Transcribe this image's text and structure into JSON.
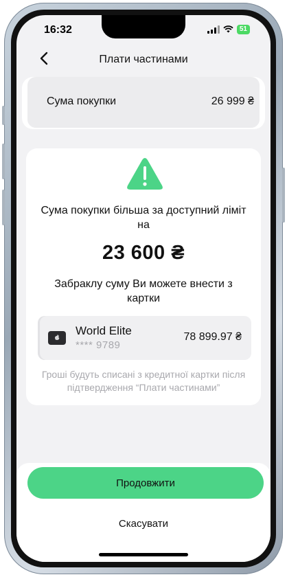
{
  "status": {
    "time": "16:32",
    "battery": "51"
  },
  "header": {
    "title": "Плати частинами"
  },
  "purchase": {
    "label": "Сума покупки",
    "amount": "26 999 ₴"
  },
  "warning": {
    "text": "Сума покупки більша за доступний ліміт на",
    "amount": "23 600 ₴",
    "remainder_text": "Забраклу суму Ви можете внести з картки"
  },
  "card": {
    "name": "World Elite",
    "number": "**** 9789",
    "balance": "78 899.97 ₴"
  },
  "note": "Гроші будуть списані з кредитної картки після підтвердження “Плати частинами”",
  "actions": {
    "continue_label": "Продовжити",
    "cancel_label": "Скасувати"
  },
  "colors": {
    "accent": "#4cd487",
    "background": "#f2f2f4",
    "muted_text": "#a8a8ad"
  },
  "icons": {
    "back": "chevron-left-icon",
    "warning": "warning-triangle-icon",
    "card": "apple-card-icon"
  }
}
